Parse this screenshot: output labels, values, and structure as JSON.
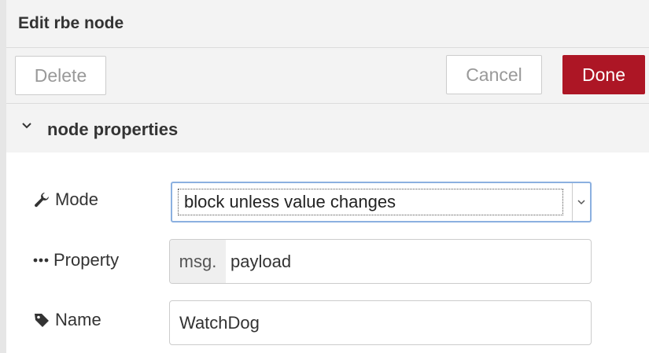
{
  "tray": {
    "title": "Edit rbe node"
  },
  "toolbar": {
    "delete_label": "Delete",
    "cancel_label": "Cancel",
    "done_label": "Done"
  },
  "colors": {
    "primary": "#ad1625",
    "focus": "#8bb0e0",
    "header_bg": "#f3f3f3"
  },
  "section": {
    "title": "node properties",
    "icon": "chevron-down-icon"
  },
  "form": {
    "mode": {
      "label": "Mode",
      "icon": "wrench-icon",
      "value": "block unless value changes"
    },
    "property": {
      "label": "Property",
      "icon": "ellipsis-icon",
      "type_prefix": "msg.",
      "value": "payload"
    },
    "name": {
      "label": "Name",
      "icon": "tag-icon",
      "value": "WatchDog"
    }
  }
}
